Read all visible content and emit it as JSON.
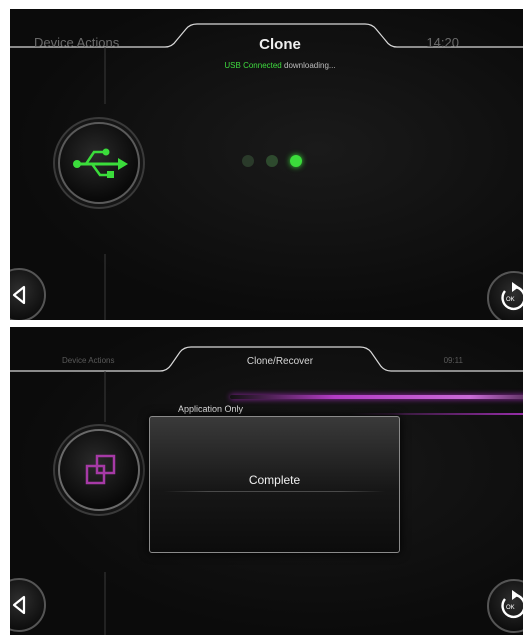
{
  "top_panel": {
    "header": {
      "left_label": "Device Actions",
      "title": "Clone",
      "time": "14:20"
    },
    "status": {
      "highlight": "USB Connected",
      "text": "downloading..."
    },
    "main_icon": "usb-icon",
    "progress_dots": {
      "total": 3,
      "active": 3,
      "inactive_color": "#2e4a2e",
      "active_color": "#3bdc3b"
    },
    "back_icon": "back-triangle-icon",
    "ok_icon": "ok-refresh-icon",
    "ok_label": "OK"
  },
  "bottom_panel": {
    "header": {
      "left_label": "Device Actions",
      "title": "Clone/Recover",
      "time": "09:11"
    },
    "selection_label": "Application Only",
    "main_icon": "clone-squares-icon",
    "dialog": {
      "message": "Complete"
    },
    "back_icon": "back-triangle-icon",
    "ok_icon": "ok-refresh-icon",
    "ok_label": "OK"
  },
  "colors": {
    "accent_green": "#3bdc3b",
    "accent_purple": "#b23cc4"
  }
}
